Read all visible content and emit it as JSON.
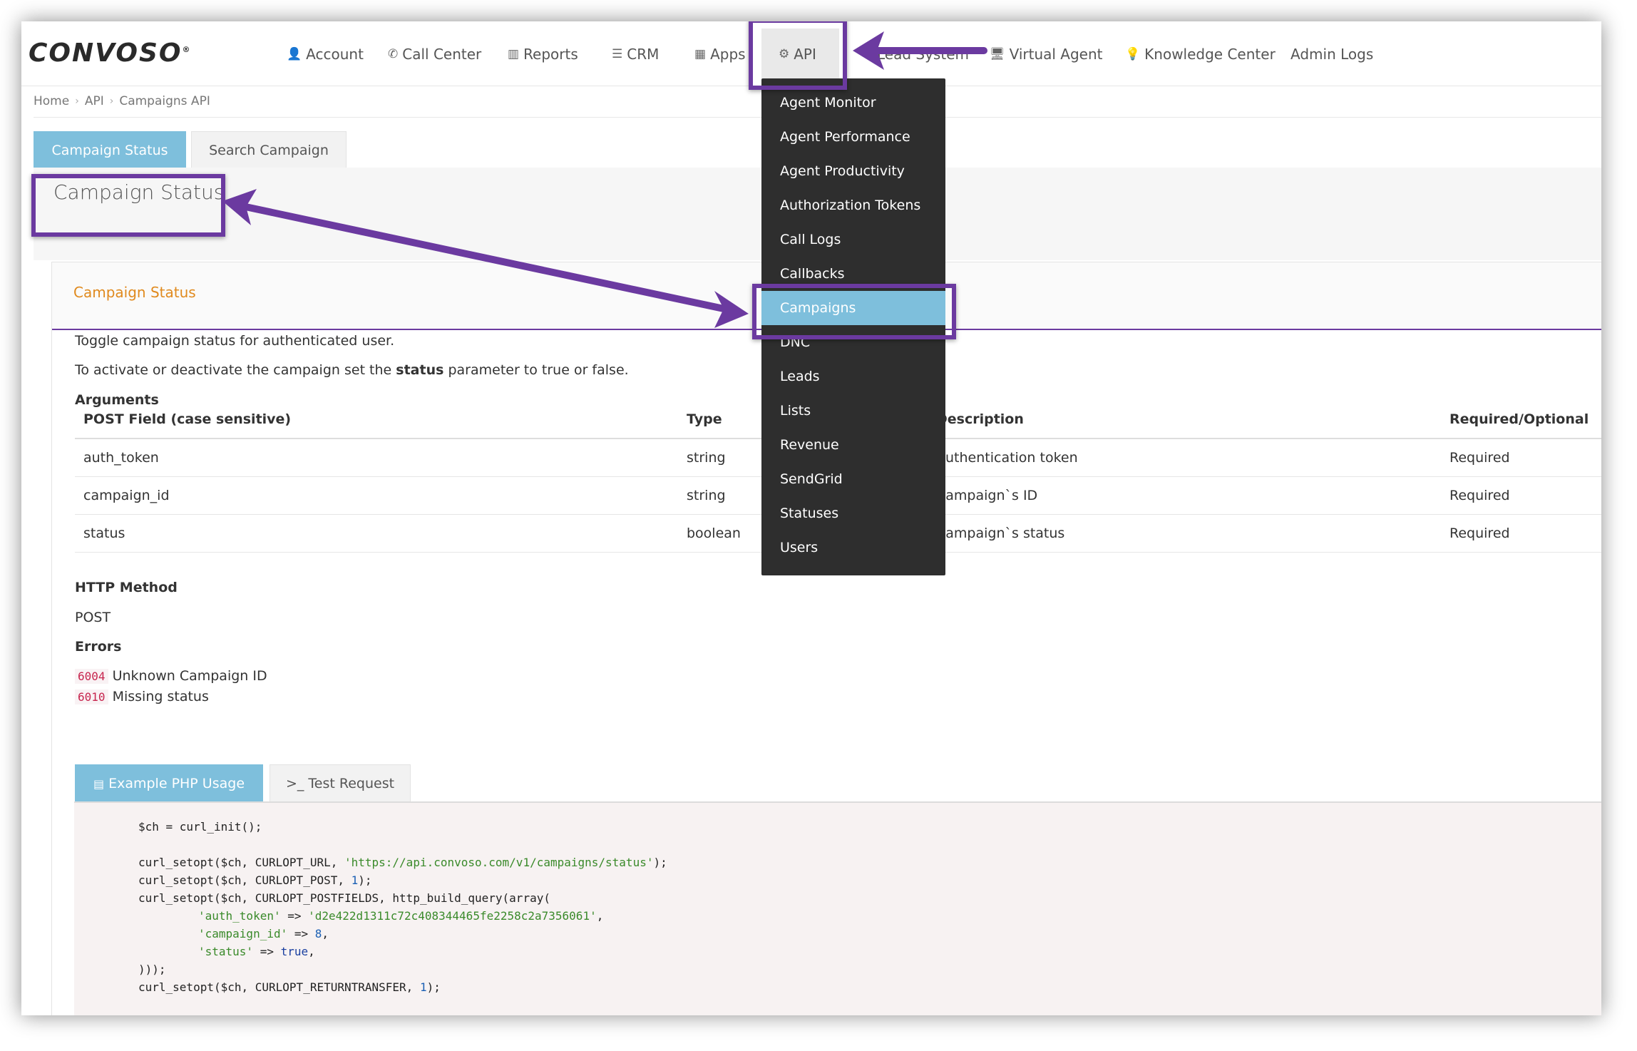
{
  "brand": {
    "logo_text": "CONVOSO",
    "logo_mark": "®"
  },
  "nav": {
    "items": [
      {
        "icon": "user-icon",
        "glyph": "👤",
        "label": "Account"
      },
      {
        "icon": "phone-icon",
        "glyph": "✆",
        "label": "Call Center"
      },
      {
        "icon": "bar-chart-icon",
        "glyph": "▥",
        "label": "Reports"
      },
      {
        "icon": "list-icon",
        "glyph": "☰",
        "label": "CRM"
      },
      {
        "icon": "grid-icon",
        "glyph": "▦",
        "label": "Apps"
      },
      {
        "icon": "gear-icon",
        "glyph": "⚙",
        "label": "API"
      },
      {
        "icon": "",
        "glyph": "",
        "label": "Lead System"
      },
      {
        "icon": "monitor-icon",
        "glyph": "🖥",
        "label": "Virtual Agent"
      },
      {
        "icon": "lightbulb-icon",
        "glyph": "💡",
        "label": "Knowledge Center"
      },
      {
        "icon": "",
        "glyph": "",
        "label": "Admin Logs"
      }
    ]
  },
  "breadcrumb": [
    "Home",
    "API",
    "Campaigns API"
  ],
  "tabs": {
    "active": "Campaign Status",
    "inactive": "Search Campaign"
  },
  "page_title": "Campaign Status",
  "panel": {
    "title": "Campaign Status",
    "desc1": "Toggle campaign status for authenticated user.",
    "desc2_pre": "To activate or deactivate the campaign set the ",
    "desc2_bold": "status",
    "desc2_post": " parameter to true or false.",
    "arguments_label": "Arguments",
    "table": {
      "headers": [
        "POST Field (case sensitive)",
        "Type",
        "Description",
        "Required/Optional"
      ],
      "rows": [
        [
          "auth_token",
          "string",
          "Authentication token",
          "Required"
        ],
        [
          "campaign_id",
          "string",
          "Campaign`s ID",
          "Required"
        ],
        [
          "status",
          "boolean",
          "Campaign`s status",
          "Required"
        ]
      ]
    },
    "http_method_label": "HTTP Method",
    "http_method": "POST",
    "errors_label": "Errors",
    "errors": [
      {
        "code": "6004",
        "message": "Unknown Campaign ID"
      },
      {
        "code": "6010",
        "message": "Missing status"
      }
    ]
  },
  "code_tabs": {
    "active": "Example PHP Usage",
    "inactive": ">_ Test Request"
  },
  "code": {
    "l1": "$ch = curl_init();",
    "l2a": "curl_setopt($ch, CURLOPT_URL, ",
    "l2s": "'https://api.convoso.com/v1/campaigns/status'",
    "l2b": ");",
    "l3a": "curl_setopt($ch, CURLOPT_POST, ",
    "l3n": "1",
    "l3b": ");",
    "l4": "curl_setopt($ch, CURLOPT_POSTFIELDS, http_build_query(array(",
    "l5s": "'auth_token'",
    "l5m": " => ",
    "l5v": "'d2e422d1311c72c408344465fe2258c2a7356061'",
    "l5e": ",",
    "l6s": "'campaign_id'",
    "l6m": " => ",
    "l6v": "8",
    "l6e": ",",
    "l7s": "'status'",
    "l7m": " => ",
    "l7v": "true",
    "l7e": ",",
    "l8": ")));",
    "l9a": "curl_setopt($ch, CURLOPT_RETURNTRANSFER, ",
    "l9n": "1",
    "l9b": ");"
  },
  "dropdown": {
    "items": [
      "Agent Monitor",
      "Agent Performance",
      "Agent Productivity",
      "Authorization Tokens",
      "Call Logs",
      "Callbacks",
      "Campaigns",
      "DNC",
      "Leads",
      "Lists",
      "Revenue",
      "SendGrid",
      "Statuses",
      "Users"
    ],
    "active_index": 6
  },
  "colors": {
    "accent": "#7ebfdc",
    "highlight": "#6b3aa0",
    "required": "#d9312b",
    "panel_title": "#e08a1e"
  }
}
